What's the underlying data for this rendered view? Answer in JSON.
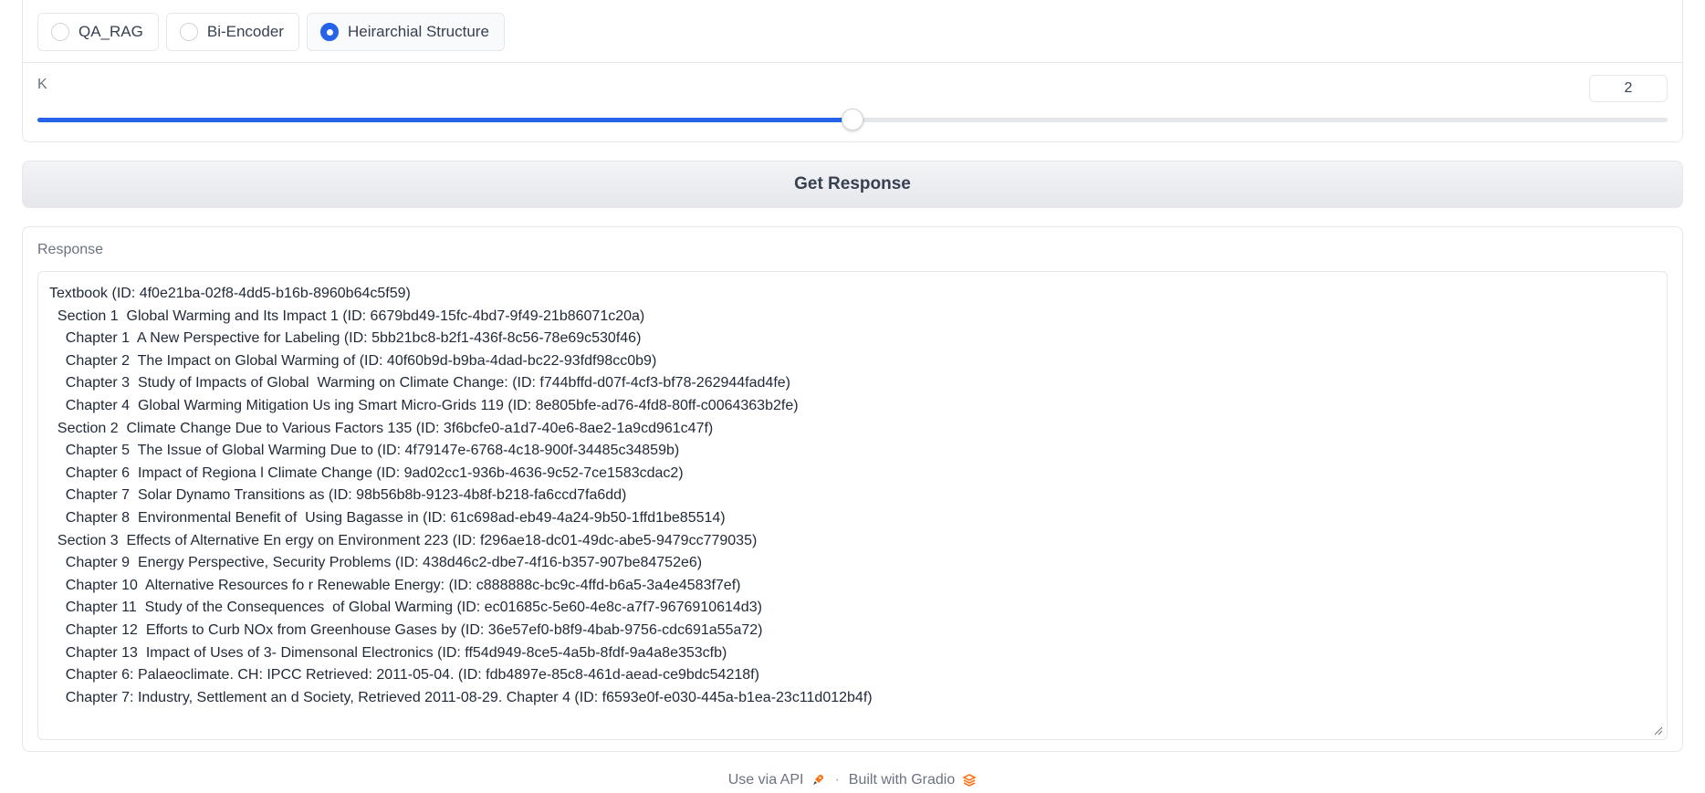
{
  "options": {
    "items": [
      {
        "label": "QA_RAG",
        "selected": false
      },
      {
        "label": "Bi-Encoder",
        "selected": false
      },
      {
        "label": "Heirarchial Structure",
        "selected": true
      }
    ]
  },
  "k": {
    "label": "K",
    "value": "2",
    "min": 1,
    "max": 3
  },
  "button": {
    "label": "Get Response"
  },
  "response": {
    "label": "Response",
    "lines": [
      "Textbook (ID: 4f0e21ba-02f8-4dd5-b16b-8960b64c5f59)",
      "  Section 1  Global Warming and Its Impact 1 (ID: 6679bd49-15fc-4bd7-9f49-21b86071c20a)",
      "    Chapter 1  A New Perspective for Labeling (ID: 5bb21bc8-b2f1-436f-8c56-78e69c530f46)",
      "    Chapter 2  The Impact on Global Warming of (ID: 40f60b9d-b9ba-4dad-bc22-93fdf98cc0b9)",
      "    Chapter 3  Study of Impacts of Global  Warming on Climate Change: (ID: f744bffd-d07f-4cf3-bf78-262944fad4fe)",
      "    Chapter 4  Global Warming Mitigation Us ing Smart Micro-Grids 119 (ID: 8e805bfe-ad76-4fd8-80ff-c0064363b2fe)",
      "  Section 2  Climate Change Due to Various Factors 135 (ID: 3f6bcfe0-a1d7-40e6-8ae2-1a9cd961c47f)",
      "    Chapter 5  The Issue of Global Warming Due to (ID: 4f79147e-6768-4c18-900f-34485c34859b)",
      "    Chapter 6  Impact of Regiona l Climate Change (ID: 9ad02cc1-936b-4636-9c52-7ce1583cdac2)",
      "    Chapter 7  Solar Dynamo Transitions as (ID: 98b56b8b-9123-4b8f-b218-fa6ccd7fa6dd)",
      "    Chapter 8  Environmental Benefit of  Using Bagasse in (ID: 61c698ad-eb49-4a24-9b50-1ffd1be85514)",
      "  Section 3  Effects of Alternative En ergy on Environment 223 (ID: f296ae18-dc01-49dc-abe5-9479cc779035)",
      "    Chapter 9  Energy Perspective, Security Problems (ID: 438d46c2-dbe7-4f16-b357-907be84752e6)",
      "    Chapter 10  Alternative Resources fo r Renewable Energy: (ID: c888888c-bc9c-4ffd-b6a5-3a4e4583f7ef)",
      "    Chapter 11  Study of the Consequences  of Global Warming (ID: ec01685c-5e60-4e8c-a7f7-9676910614d3)",
      "    Chapter 12  Efforts to Curb NOx from Greenhouse Gases by (ID: 36e57ef0-b8f9-4bab-9756-cdc691a55a72)",
      "    Chapter 13  Impact of Uses of 3- Dimensonal Electronics (ID: ff54d949-8ce5-4a5b-8fdf-9a4a8e353cfb)",
      "    Chapter 6: Palaeoclimate. CH: IPCC Retrieved: 2011-05-04. (ID: fdb4897e-85c8-461d-aead-ce9bdc54218f)",
      "    Chapter 7: Industry, Settlement an d Society, Retrieved 2011-08-29. Chapter 4 (ID: f6593e0f-e030-445a-b1ea-23c11d012b4f)"
    ]
  },
  "footer": {
    "api_label": "Use via API",
    "separator": "·",
    "built_label": "Built with Gradio",
    "api_icon": "rocket-icon",
    "gradio_icon": "gradio-logo-icon"
  },
  "colors": {
    "accent": "#2563eb",
    "gradio_orange": "#f97316"
  }
}
